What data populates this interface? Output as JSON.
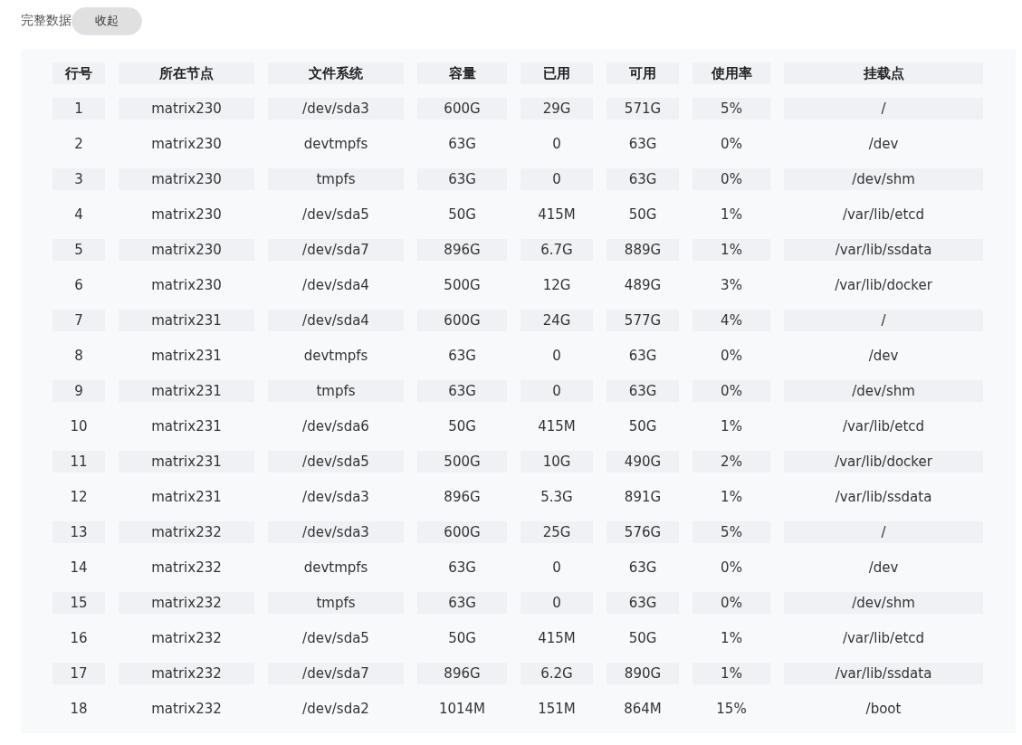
{
  "header": {
    "label": "完整数据",
    "button": "收起"
  },
  "table": {
    "columns": [
      "行号",
      "所在节点",
      "文件系统",
      "容量",
      "已用",
      "可用",
      "使用率",
      "挂载点"
    ],
    "rows": [
      [
        "1",
        "matrix230",
        "/dev/sda3",
        "600G",
        "29G",
        "571G",
        "5%",
        "/"
      ],
      [
        "2",
        "matrix230",
        "devtmpfs",
        "63G",
        "0",
        "63G",
        "0%",
        "/dev"
      ],
      [
        "3",
        "matrix230",
        "tmpfs",
        "63G",
        "0",
        "63G",
        "0%",
        "/dev/shm"
      ],
      [
        "4",
        "matrix230",
        "/dev/sda5",
        "50G",
        "415M",
        "50G",
        "1%",
        "/var/lib/etcd"
      ],
      [
        "5",
        "matrix230",
        "/dev/sda7",
        "896G",
        "6.7G",
        "889G",
        "1%",
        "/var/lib/ssdata"
      ],
      [
        "6",
        "matrix230",
        "/dev/sda4",
        "500G",
        "12G",
        "489G",
        "3%",
        "/var/lib/docker"
      ],
      [
        "7",
        "matrix231",
        "/dev/sda4",
        "600G",
        "24G",
        "577G",
        "4%",
        "/"
      ],
      [
        "8",
        "matrix231",
        "devtmpfs",
        "63G",
        "0",
        "63G",
        "0%",
        "/dev"
      ],
      [
        "9",
        "matrix231",
        "tmpfs",
        "63G",
        "0",
        "63G",
        "0%",
        "/dev/shm"
      ],
      [
        "10",
        "matrix231",
        "/dev/sda6",
        "50G",
        "415M",
        "50G",
        "1%",
        "/var/lib/etcd"
      ],
      [
        "11",
        "matrix231",
        "/dev/sda5",
        "500G",
        "10G",
        "490G",
        "2%",
        "/var/lib/docker"
      ],
      [
        "12",
        "matrix231",
        "/dev/sda3",
        "896G",
        "5.3G",
        "891G",
        "1%",
        "/var/lib/ssdata"
      ],
      [
        "13",
        "matrix232",
        "/dev/sda3",
        "600G",
        "25G",
        "576G",
        "5%",
        "/"
      ],
      [
        "14",
        "matrix232",
        "devtmpfs",
        "63G",
        "0",
        "63G",
        "0%",
        "/dev"
      ],
      [
        "15",
        "matrix232",
        "tmpfs",
        "63G",
        "0",
        "63G",
        "0%",
        "/dev/shm"
      ],
      [
        "16",
        "matrix232",
        "/dev/sda5",
        "50G",
        "415M",
        "50G",
        "1%",
        "/var/lib/etcd"
      ],
      [
        "17",
        "matrix232",
        "/dev/sda7",
        "896G",
        "6.2G",
        "890G",
        "1%",
        "/var/lib/ssdata"
      ],
      [
        "18",
        "matrix232",
        "/dev/sda2",
        "1014M",
        "151M",
        "864M",
        "15%",
        "/boot"
      ]
    ]
  }
}
